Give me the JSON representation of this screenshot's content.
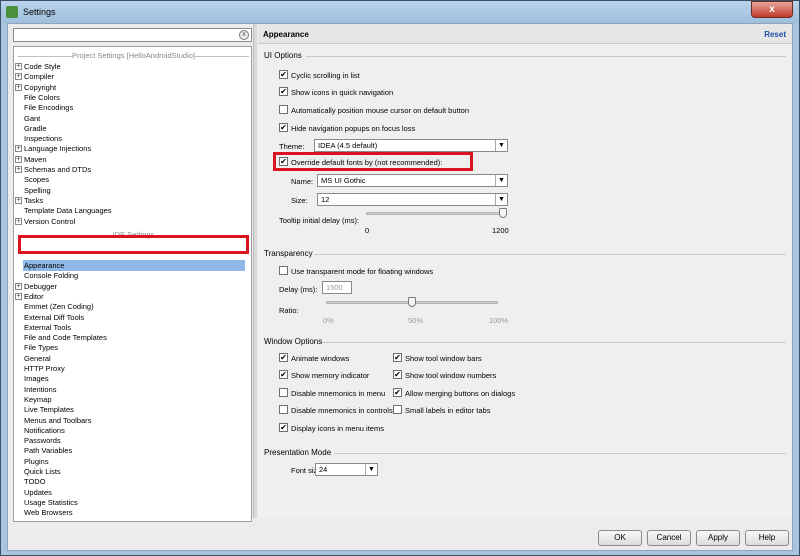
{
  "window": {
    "title": "Settings",
    "close": "x"
  },
  "search": {
    "value": "",
    "clear": "x"
  },
  "tree": {
    "project_header": "Project Settings [HelloAndroidStudio]",
    "ide_header": "IDE Settings",
    "project_items": [
      {
        "label": "Code Style",
        "exp": "+"
      },
      {
        "label": "Compiler",
        "exp": "+"
      },
      {
        "label": "Copyright",
        "exp": "+"
      },
      {
        "label": "File Colors",
        "exp": ""
      },
      {
        "label": "File Encodings",
        "exp": ""
      },
      {
        "label": "Gant",
        "exp": ""
      },
      {
        "label": "Gradle",
        "exp": ""
      },
      {
        "label": "Inspections",
        "exp": ""
      },
      {
        "label": "Language Injections",
        "exp": "+"
      },
      {
        "label": "Maven",
        "exp": "+"
      },
      {
        "label": "Schemas and DTDs",
        "exp": "+"
      },
      {
        "label": "Scopes",
        "exp": ""
      },
      {
        "label": "Spelling",
        "exp": ""
      },
      {
        "label": "Tasks",
        "exp": "+"
      },
      {
        "label": "Template Data Languages",
        "exp": ""
      },
      {
        "label": "Version Control",
        "exp": "+"
      }
    ],
    "ide_items": [
      {
        "label": "Appearance",
        "exp": ""
      },
      {
        "label": "Console Folding",
        "exp": ""
      },
      {
        "label": "Debugger",
        "exp": "+"
      },
      {
        "label": "Editor",
        "exp": "+"
      },
      {
        "label": "Emmet (Zen Coding)",
        "exp": ""
      },
      {
        "label": "External Diff Tools",
        "exp": ""
      },
      {
        "label": "External Tools",
        "exp": ""
      },
      {
        "label": "File and Code Templates",
        "exp": ""
      },
      {
        "label": "File Types",
        "exp": ""
      },
      {
        "label": "General",
        "exp": ""
      },
      {
        "label": "HTTP Proxy",
        "exp": ""
      },
      {
        "label": "Images",
        "exp": ""
      },
      {
        "label": "Intentions",
        "exp": ""
      },
      {
        "label": "Keymap",
        "exp": ""
      },
      {
        "label": "Live Templates",
        "exp": ""
      },
      {
        "label": "Menus and Toolbars",
        "exp": ""
      },
      {
        "label": "Notifications",
        "exp": ""
      },
      {
        "label": "Passwords",
        "exp": ""
      },
      {
        "label": "Path Variables",
        "exp": ""
      },
      {
        "label": "Plugins",
        "exp": ""
      },
      {
        "label": "Quick Lists",
        "exp": ""
      },
      {
        "label": "TODO",
        "exp": ""
      },
      {
        "label": "Updates",
        "exp": ""
      },
      {
        "label": "Usage Statistics",
        "exp": ""
      },
      {
        "label": "Web Browsers",
        "exp": ""
      }
    ],
    "selected": "Appearance"
  },
  "panel": {
    "title": "Appearance",
    "reset": "Reset",
    "ui_options": {
      "header": "UI Options",
      "cyclic": {
        "label": "Cyclic scrolling in list",
        "checked": true,
        "mark": "✔"
      },
      "show_icons": {
        "label": "Show icons in quick navigation",
        "checked": true,
        "mark": "✔"
      },
      "auto_mouse": {
        "label": "Automatically position mouse cursor on default button",
        "checked": false,
        "mark": ""
      },
      "hide_nav": {
        "label": "Hide navigation popups on focus loss",
        "checked": true,
        "mark": "✔"
      },
      "theme_label": "Theme:",
      "theme_value": "IDEA (4.5 default)",
      "override": {
        "label": "Override default fonts by (not recommended):",
        "checked": true,
        "mark": "✔"
      },
      "name_label": "Name:",
      "name_value": "MS UI Gothic",
      "size_label": "Size:",
      "size_value": "12",
      "tooltip_label": "Tooltip initial delay (ms):",
      "tooltip_min": "0",
      "tooltip_max": "1200",
      "tooltip_value": 1200
    },
    "transparency": {
      "header": "Transparency",
      "use": {
        "label": "Use transparent mode for floating windows",
        "checked": false,
        "mark": ""
      },
      "delay_label": "Delay (ms):",
      "delay_value": "1500",
      "ratio_label": "Ratio:",
      "ratio_ticks": [
        "0%",
        "50%",
        "100%"
      ],
      "ratio_value": 50
    },
    "window_options": {
      "header": "Window Options",
      "animate": {
        "label": "Animate windows",
        "checked": true,
        "mark": "✔"
      },
      "memory": {
        "label": "Show memory indicator",
        "checked": true,
        "mark": "✔"
      },
      "disable_menu": {
        "label": "Disable mnemonics in menu",
        "checked": false,
        "mark": ""
      },
      "disable_controls": {
        "label": "Disable mnemonics in controls",
        "checked": false,
        "mark": ""
      },
      "display_icons": {
        "label": "Display icons in menu items",
        "checked": true,
        "mark": "✔"
      },
      "tool_bars": {
        "label": "Show tool window bars",
        "checked": true,
        "mark": "✔"
      },
      "tool_numbers": {
        "label": "Show tool window numbers",
        "checked": true,
        "mark": "✔"
      },
      "merging": {
        "label": "Allow merging buttons on dialogs",
        "checked": true,
        "mark": "✔"
      },
      "small_labels": {
        "label": "Small labels in editor tabs",
        "checked": false,
        "mark": ""
      }
    },
    "presentation": {
      "header": "Presentation Mode",
      "font_label": "Font size:",
      "font_value": "24"
    }
  },
  "buttons": {
    "ok": "OK",
    "cancel": "Cancel",
    "apply": "Apply",
    "help": "Help"
  },
  "colors": {
    "highlight": "#d9141e",
    "selection": "#8fb8e8",
    "link": "#1f4fa8"
  }
}
